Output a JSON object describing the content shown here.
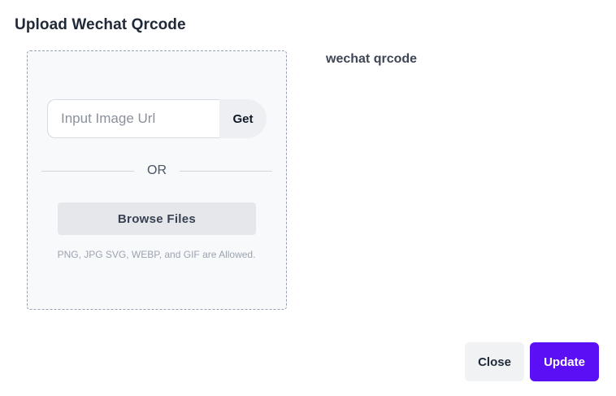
{
  "dialog": {
    "title": "Upload Wechat Qrcode"
  },
  "upload": {
    "url_placeholder": "Input Image Url",
    "url_value": "",
    "get_label": "Get",
    "or_label": "OR",
    "browse_label": "Browse Files",
    "allowed_text": "PNG, JPG SVG, WEBP, and GIF are Allowed."
  },
  "preview": {
    "label": "wechat qrcode"
  },
  "footer": {
    "close_label": "Close",
    "update_label": "Update"
  },
  "colors": {
    "accent": "#5b0ff5",
    "dropzone_border": "#9aa0b4",
    "dropzone_bg": "#f8f9fb"
  }
}
